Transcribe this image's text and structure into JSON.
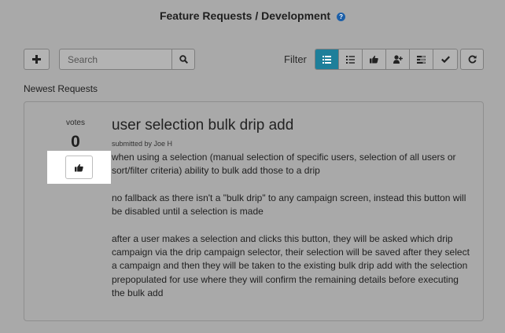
{
  "header": {
    "title": "Feature Requests / Development",
    "help_icon": "question-circle-icon",
    "help_glyph": "?"
  },
  "toolbar": {
    "add_icon": "plus-icon",
    "search": {
      "placeholder": "Search",
      "value": ""
    },
    "search_icon": "magnifier-icon",
    "filter_label": "Filter",
    "filters": [
      {
        "icon": "list-icon",
        "active": true
      },
      {
        "icon": "ordered-list-icon",
        "active": false
      },
      {
        "icon": "thumbs-up-icon",
        "active": false
      },
      {
        "icon": "user-plus-icon",
        "active": false
      },
      {
        "icon": "tasks-icon",
        "active": false
      },
      {
        "icon": "check-icon",
        "active": false
      }
    ],
    "refresh_icon": "refresh-icon"
  },
  "section_label": "Newest Requests",
  "request": {
    "votes_label": "votes",
    "votes_count": "0",
    "title": "user selection bulk drip add",
    "submitted_by": "submitted by Joe H",
    "paragraphs": [
      "when using a selection (manual selection of specific users, selection of all users or sort/filter criteria) ability to bulk add those to a drip",
      "no fallback as there isn't a \"bulk drip\" to any campaign screen, instead this button will be disabled until a selection is made",
      "after a user makes a selection and clicks this button, they will be asked which drip campaign via the drip campaign selector, their selection will be saved after they select a campaign and then they will be taken to the existing bulk drip add with the selection prepopulated for use where they will confirm the remaining details before executing the bulk add"
    ]
  },
  "colors": {
    "overlay_background": "#a9a9a9",
    "active_filter": "#1d7f9a",
    "help_icon": "#1c5fa8",
    "highlight": "#ffffff"
  }
}
